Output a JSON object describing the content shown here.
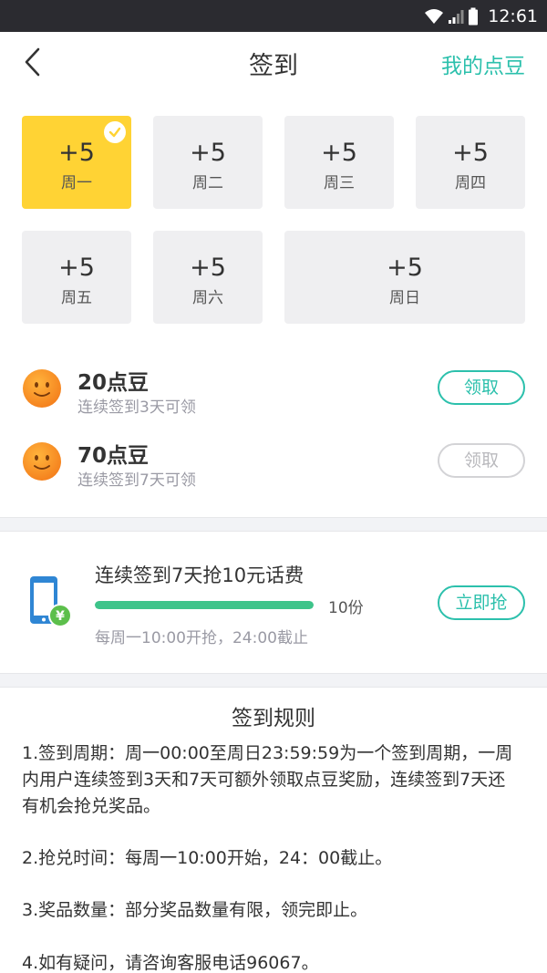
{
  "status_bar": {
    "time": "12:61"
  },
  "nav": {
    "title": "签到",
    "action": "我的点豆"
  },
  "days": [
    {
      "points": "+5",
      "label": "周一",
      "checked": true
    },
    {
      "points": "+5",
      "label": "周二",
      "checked": false
    },
    {
      "points": "+5",
      "label": "周三",
      "checked": false
    },
    {
      "points": "+5",
      "label": "周四",
      "checked": false
    },
    {
      "points": "+5",
      "label": "周五",
      "checked": false
    },
    {
      "points": "+5",
      "label": "周六",
      "checked": false
    },
    {
      "points": "+5",
      "label": "周日",
      "checked": false
    }
  ],
  "rewards": [
    {
      "title": "20点豆",
      "desc": "连续签到3天可领",
      "button": "领取",
      "enabled": true,
      "icon": "smiley-icon"
    },
    {
      "title": "70点豆",
      "desc": "连续签到7天可领",
      "button": "领取",
      "enabled": false,
      "icon": "smiley-icon"
    }
  ],
  "promo": {
    "title": "连续签到7天抢10元话费",
    "progress": 1.0,
    "count": "10份",
    "subtitle": "每周一10:00开抢，24:00截止",
    "button": "立即抢",
    "icon": "phone-yuan-icon"
  },
  "rules": {
    "title": "签到规则",
    "items": [
      "1.签到周期：周一00:00至周日23:59:59为一个签到周期，一周内用户连续签到3天和7天可额外领取点豆奖励，连续签到7天还有机会抢兑奖品。",
      "2.抢兑时间：每周一10:00开始，24：00截止。",
      "3.奖品数量：部分奖品数量有限，领完即止。",
      "4.如有疑问，请咨询客服电话96067。"
    ]
  },
  "colors": {
    "accent": "#2cc0ac",
    "active_day": "#ffd334",
    "progress": "#3dc48a"
  }
}
